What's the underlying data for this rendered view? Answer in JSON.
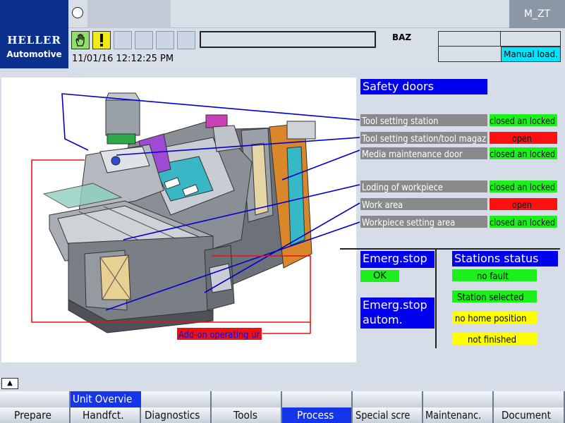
{
  "header": {
    "brand": "HELLER",
    "brand_sub": "Automotive",
    "channel": "M_ZT",
    "mode": "BAZ",
    "datetime": "11/01/16 12:12:25 PM",
    "operating_mode": "Manual load."
  },
  "safety_doors": {
    "title": "Safety doors",
    "doors": [
      {
        "label": "Tool setting station",
        "status": "closed an locked"
      },
      {
        "label": "Tool setting station/tool magaz",
        "status": "open"
      },
      {
        "label": "Media maintenance door",
        "status": "closed an locked"
      },
      {
        "label": "Loding of workpiece",
        "status": "closed an locked"
      },
      {
        "label": "Work area",
        "status": "open"
      },
      {
        "label": "Workpiece setting area",
        "status": "closed an locked"
      }
    ]
  },
  "emergency": {
    "title": "Emerg.stop",
    "status": "OK",
    "auto_title": "Emerg.stop autom."
  },
  "stations": {
    "title": "Stations status",
    "items": [
      "no fault",
      "Station selected",
      "no home position",
      "not finished"
    ]
  },
  "addon_label": "Add-on operating ur",
  "softkeys": {
    "extended": "Unit Overvie",
    "main": [
      "Prepare",
      "Handfct.",
      "Diagnostics",
      "Tools",
      "Process",
      "Special scre",
      "Maintenanc.",
      "Document"
    ]
  },
  "colors": {
    "brand": "#0a2f8c",
    "accent_blue": "#0000ee",
    "ok_green": "#1cf01c",
    "alarm_red": "#ff1010",
    "info_yellow": "#ffff00",
    "manual_cyan": "#00e4ff"
  }
}
